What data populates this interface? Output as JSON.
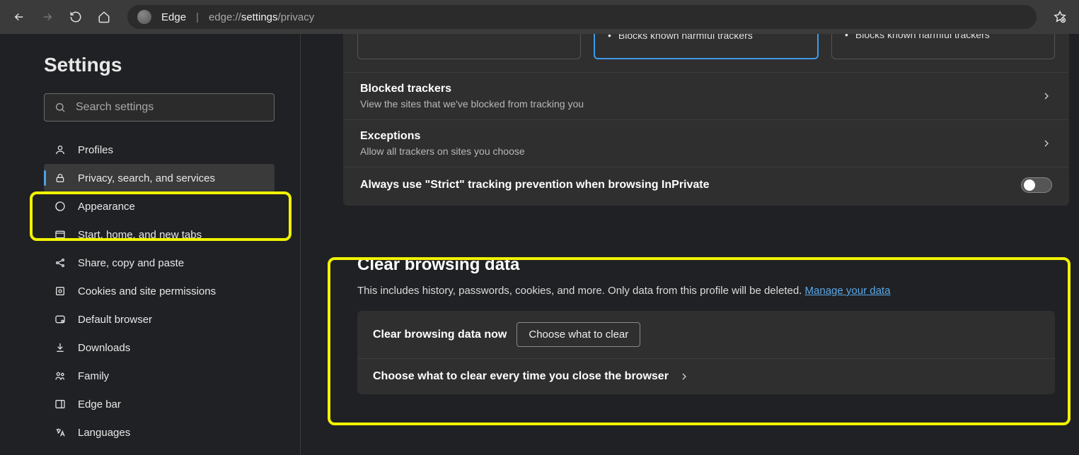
{
  "toolbar": {
    "product": "Edge",
    "url_prefix": "edge://",
    "url_emph": "settings",
    "url_suffix": "/privacy"
  },
  "sidebar": {
    "title": "Settings",
    "search_placeholder": "Search settings",
    "items": [
      {
        "label": "Profiles"
      },
      {
        "label": "Privacy, search, and services",
        "active": true
      },
      {
        "label": "Appearance"
      },
      {
        "label": "Start, home, and new tabs"
      },
      {
        "label": "Share, copy and paste"
      },
      {
        "label": "Cookies and site permissions"
      },
      {
        "label": "Default browser"
      },
      {
        "label": "Downloads"
      },
      {
        "label": "Family"
      },
      {
        "label": "Edge bar"
      },
      {
        "label": "Languages"
      }
    ]
  },
  "tracking": {
    "cards": {
      "basic_bullet": "",
      "balanced_bullet": "Blocks known harmful trackers",
      "strict_bullet": "Blocks known harmful trackers"
    },
    "blocked_title": "Blocked trackers",
    "blocked_sub": "View the sites that we've blocked from tracking you",
    "exceptions_title": "Exceptions",
    "exceptions_sub": "Allow all trackers on sites you choose",
    "strict_inprivate": "Always use \"Strict\" tracking prevention when browsing InPrivate"
  },
  "clear": {
    "title": "Clear browsing data",
    "desc": "This includes history, passwords, cookies, and more. Only data from this profile will be deleted. ",
    "link": "Manage your data",
    "row_now": "Clear browsing data now",
    "btn_choose": "Choose what to clear",
    "row_everytime": "Choose what to clear every time you close the browser"
  }
}
